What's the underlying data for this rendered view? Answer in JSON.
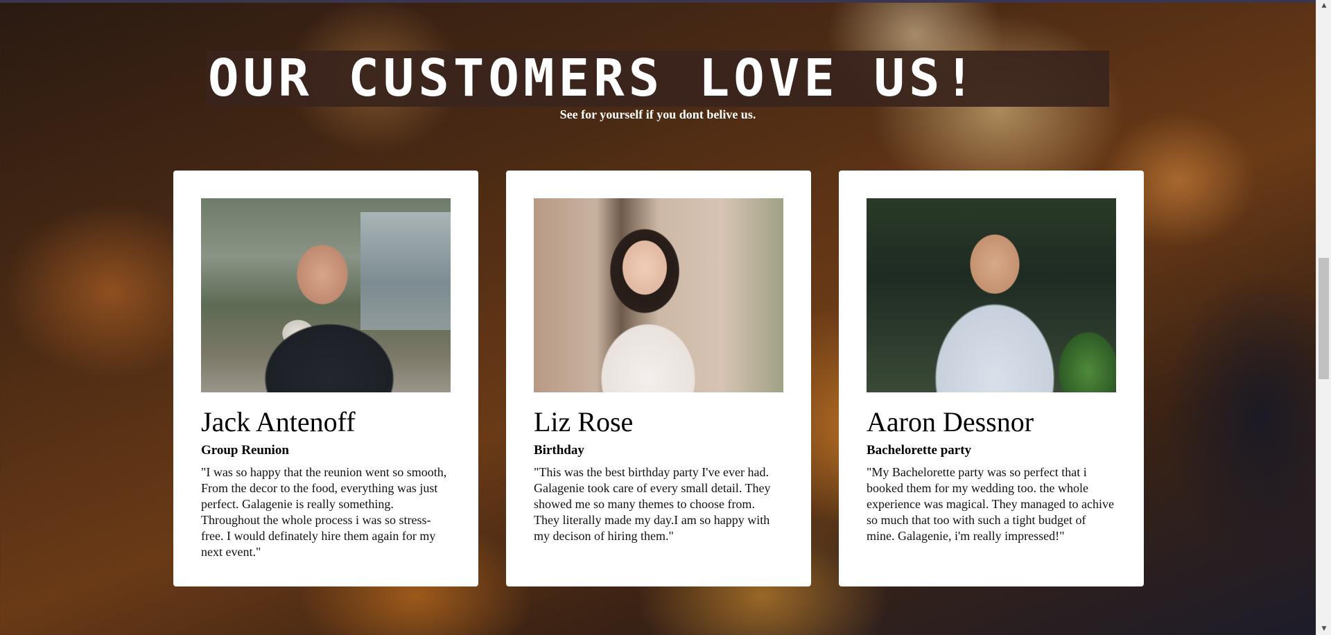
{
  "section": {
    "heading_parts": [
      {
        "text": "O",
        "bold": true
      },
      {
        "text": "UR ",
        "bold": false
      },
      {
        "text": "C",
        "bold": true
      },
      {
        "text": "USTOMERS LOVE US",
        "bold": false
      },
      {
        "text": "!",
        "bold": true
      }
    ],
    "subtitle": "See for yourself if you dont belive us."
  },
  "testimonials": [
    {
      "name": "Jack Antenoff",
      "event": "Group Reunion",
      "quote": "\"I was so happy that the reunion went so smooth, From the decor to the food, everything was just perfect. Galagenie is really something. Throughout the whole process i was so stress-free. I would definately hire them again for my next event.\"",
      "photo_alt": "smiling man holding a coffee cup by a canal"
    },
    {
      "name": "Liz Rose",
      "event": "Birthday",
      "quote": "\"This was the best birthday party I've ever had. Galagenie took care of every small detail. They showed me so many themes to choose from. They literally made my day.I am so happy with my decison of hiring them.\"",
      "photo_alt": "smiling woman with glasses sitting outdoors"
    },
    {
      "name": "Aaron Dessnor",
      "event": "Bachelorette party",
      "quote": "\"My Bachelorette party was so perfect that i booked them for my wedding too. the whole experience was magical. They managed to achive so much that too with such a tight budget of mine. Galagenie, i'm really impressed!\"",
      "photo_alt": "smiling man in sunglasses with jacket over shoulder"
    }
  ],
  "colors": {
    "heading_bg": "#3a241c",
    "card_bg": "#ffffff",
    "text_primary": "#000000",
    "heading_text": "#ffffff"
  },
  "icons": {
    "scroll_up": "▲",
    "scroll_down": "▼"
  }
}
